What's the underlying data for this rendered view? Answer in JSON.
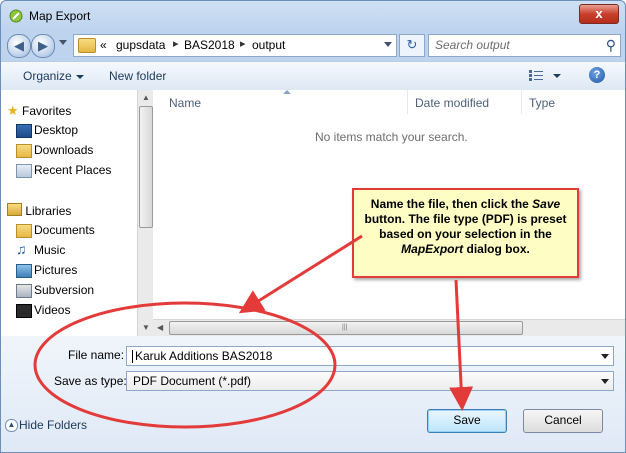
{
  "window": {
    "title": "Map Export",
    "close_label": "x"
  },
  "address": {
    "overflow": "«",
    "crumbs": [
      "gupsdata",
      "BAS2018",
      "output"
    ],
    "search_placeholder": "Search output"
  },
  "toolbar": {
    "organize_label": "Organize",
    "new_folder_label": "New folder"
  },
  "nav": {
    "favorites_label": "Favorites",
    "favorites": [
      "Desktop",
      "Downloads",
      "Recent Places"
    ],
    "libraries_label": "Libraries",
    "libraries": [
      "Documents",
      "Music",
      "Pictures",
      "Subversion",
      "Videos"
    ]
  },
  "files": {
    "columns": [
      "Name",
      "Date modified",
      "Type"
    ],
    "empty_message": "No items match your search."
  },
  "form": {
    "filename_label": "File name:",
    "filename_value": "Karuk Additions BAS2018",
    "savetype_label": "Save as type:",
    "savetype_value": "PDF Document (*.pdf)"
  },
  "buttons": {
    "hide_folders": "Hide Folders",
    "save": "Save",
    "cancel": "Cancel"
  },
  "callout": {
    "part1": "Name the file, then click the ",
    "save_word": "Save",
    "part2": " button. The file type (PDF) is preset based on your selection in the ",
    "mapexport_word": "MapExport",
    "part3": " dialog box."
  },
  "colors": {
    "annotation_red": "#e33a3a",
    "callout_fill": "#fdfdc4",
    "accent_blue": "#1e395b"
  }
}
